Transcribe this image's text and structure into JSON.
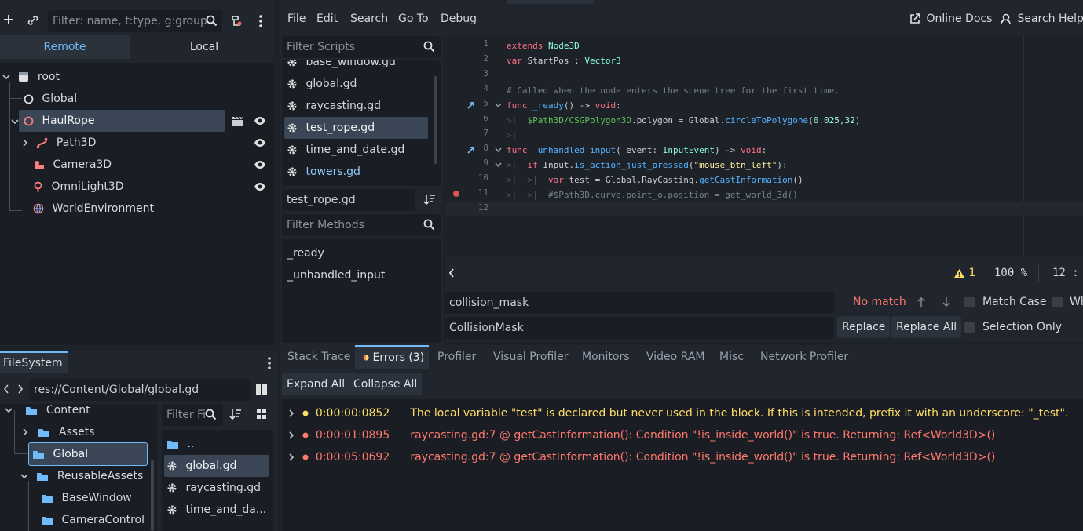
{
  "scene_panel": {
    "filter_placeholder": "Filter: name, t:type, g:group",
    "tabs": [
      "Remote",
      "Local"
    ],
    "tree": [
      {
        "label": "root"
      },
      {
        "label": "Global"
      },
      {
        "label": "HaulRope"
      },
      {
        "label": "Path3D"
      },
      {
        "label": "Camera3D"
      },
      {
        "label": "OmniLight3D"
      },
      {
        "label": "WorldEnvironment"
      }
    ]
  },
  "filesystem": {
    "tab": "FileSystem",
    "path": "res://Content/Global/global.gd",
    "tree": [
      {
        "label": "Content"
      },
      {
        "label": "Assets"
      },
      {
        "label": "Global"
      },
      {
        "label": "ReusableAssets"
      },
      {
        "label": "BaseWindow"
      },
      {
        "label": "CameraControl"
      }
    ],
    "filter_placeholder": "Filter Fi",
    "files": [
      {
        "label": ".."
      },
      {
        "label": "global.gd"
      },
      {
        "label": "raycasting.gd"
      },
      {
        "label": "time_and_da..."
      }
    ]
  },
  "menu": {
    "items": [
      "File",
      "Edit",
      "Search",
      "Go To",
      "Debug"
    ],
    "online_docs": "Online Docs",
    "search_help": "Search Help"
  },
  "scripts": {
    "filter_placeholder": "Filter Scripts",
    "list": [
      {
        "label": "base_window.gd"
      },
      {
        "label": "global.gd"
      },
      {
        "label": "raycasting.gd"
      },
      {
        "label": "test_rope.gd"
      },
      {
        "label": "time_and_date.gd"
      },
      {
        "label": "towers.gd"
      }
    ],
    "current_name": "test_rope.gd",
    "methods_placeholder": "Filter Methods",
    "methods": [
      "_ready",
      "_unhandled_input"
    ]
  },
  "editor": {
    "line_numbers": [
      "1",
      "2",
      "3",
      "4",
      "5",
      "6",
      "7",
      "8",
      "9",
      "10",
      "11",
      "12"
    ],
    "lines": [
      "extends Node3D",
      "var StartPos : Vector3",
      "",
      "# Called when the node enters the scene tree for the first time.",
      "func _ready() -> void:",
      "$Path3D/CSGPolygon3D.polygon = Global.circleToPolygone(0.025,32)",
      "",
      "func _unhandled_input(_event: InputEvent) -> void:",
      "if Input.is_action_just_pressed(\"mouse_btn_left\"):",
      "var test = Global.RayCasting.getCastInformation()",
      "#$Path3D.curve.point_o.position = get_world_3d()",
      ""
    ],
    "status": {
      "warnings": "1",
      "zoom": "100 %",
      "line": "12 :"
    }
  },
  "find_replace": {
    "find_value": "collision_mask",
    "no_match": "No match",
    "match_case": "Match Case",
    "whole_words": "Wh",
    "replace_value": "CollisionMask",
    "replace": "Replace",
    "replace_all": "Replace All",
    "selection_only": "Selection Only"
  },
  "bottom_panel": {
    "tabs": [
      "Stack Trace",
      "Errors (3)",
      "Profiler",
      "Visual Profiler",
      "Monitors",
      "Video RAM",
      "Misc",
      "Network Profiler"
    ],
    "expand_all": "Expand All",
    "collapse_all": "Collapse All",
    "errors": [
      {
        "time": "0:00:00:0852",
        "message": "The local variable \"test\" is declared but never used in the block. If this is intended, prefix it with an underscore: \"_test\".",
        "level": "warning"
      },
      {
        "time": "0:00:01:0895",
        "message": "raycasting.gd:7 @ getCastInformation(): Condition \"!is_inside_world()\" is true. Returning: Ref<World3D>()",
        "level": "error"
      },
      {
        "time": "0:00:05:0692",
        "message": "raycasting.gd:7 @ getCastInformation(): Condition \"!is_inside_world()\" is true. Returning: Ref<World3D>()",
        "level": "error"
      }
    ]
  },
  "colors": {
    "accent": "#70bafa",
    "error": "#ff786b",
    "warning": "#ffdd65",
    "keyword": "#ff7085",
    "type": "#8effda"
  }
}
